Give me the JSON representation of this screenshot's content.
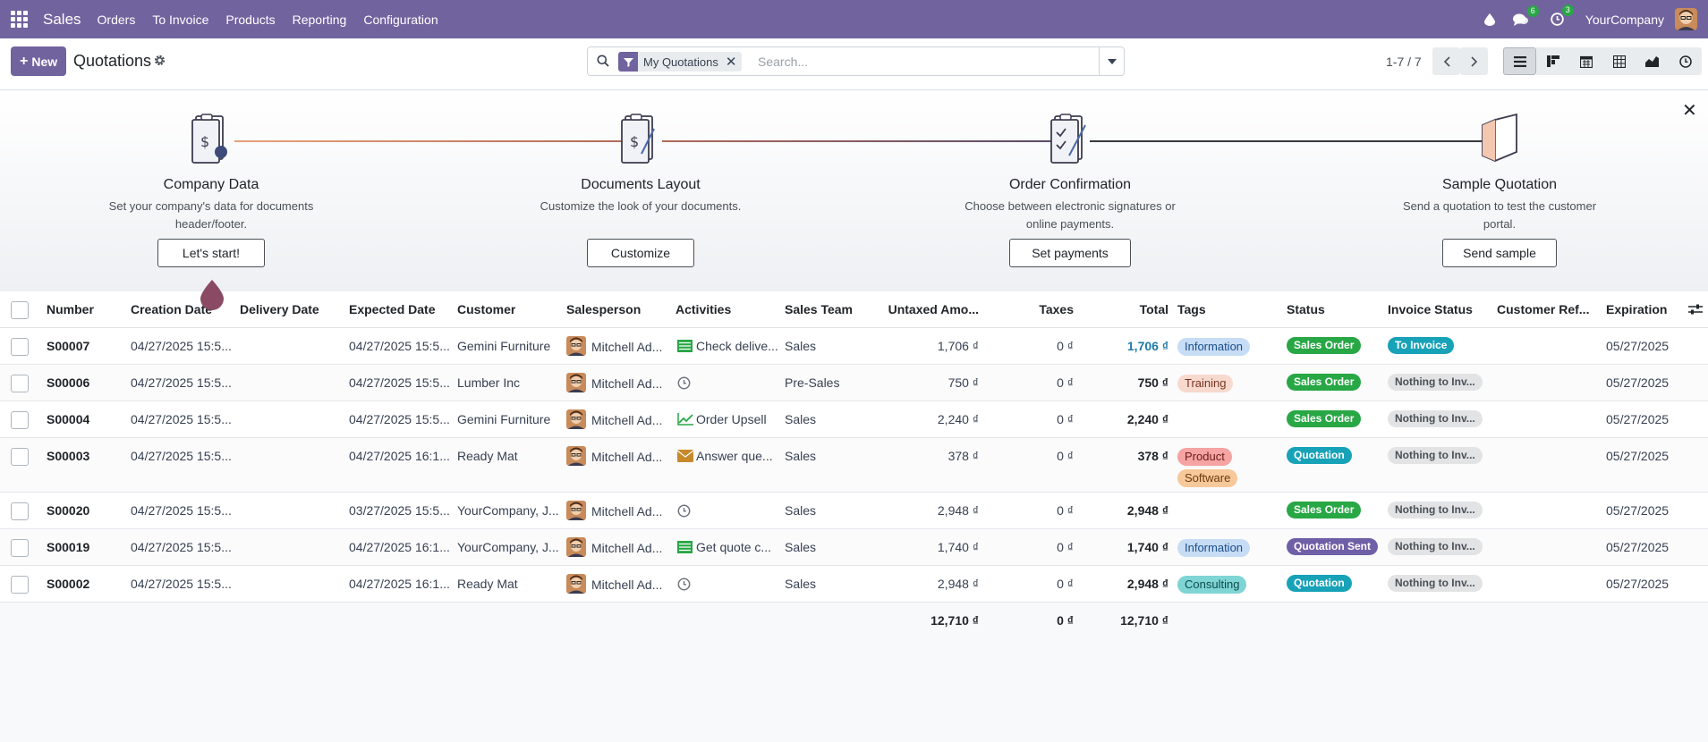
{
  "navbar": {
    "brand": "Sales",
    "menu": [
      "Orders",
      "To Invoice",
      "Products",
      "Reporting",
      "Configuration"
    ],
    "messages_count": "6",
    "activities_count": "3",
    "company": "YourCompany"
  },
  "control": {
    "new_label": "New",
    "title": "Quotations",
    "facet": "My Quotations",
    "search_placeholder": "Search...",
    "pager": "1-7 / 7"
  },
  "onboarding": {
    "steps": [
      {
        "title": "Company Data",
        "desc": "Set your company's data for documents header/footer.",
        "button": "Let's start!"
      },
      {
        "title": "Documents Layout",
        "desc": "Customize the look of your documents.",
        "button": "Customize"
      },
      {
        "title": "Order Confirmation",
        "desc": "Choose between electronic signatures or online payments.",
        "button": "Set payments"
      },
      {
        "title": "Sample Quotation",
        "desc": "Send a quotation to test the customer portal.",
        "button": "Send sample"
      }
    ]
  },
  "table": {
    "headers": [
      "Number",
      "Creation Date",
      "Delivery Date",
      "Expected Date",
      "Customer",
      "Salesperson",
      "Activities",
      "Sales Team",
      "Untaxed Amo...",
      "Taxes",
      "Total",
      "Tags",
      "Status",
      "Invoice Status",
      "Customer Ref...",
      "Expiration"
    ],
    "rows": [
      {
        "number": "S00007",
        "created": "04/27/2025 15:5...",
        "expected": "04/27/2025 15:5...",
        "customer": "Gemini Furniture",
        "salesperson": "Mitchell Ad...",
        "activity_icon": "list-icon",
        "activity": "Check delive...",
        "team": "Sales",
        "untaxed": "1,706 ₫",
        "taxes": "0 ₫",
        "total": "1,706 ₫",
        "tags": [
          {
            "label": "Information",
            "bg": "#c7dcf5",
            "fg": "#1a4f8b"
          }
        ],
        "status": {
          "label": "Sales Order",
          "bg": "#28a745"
        },
        "invoice": {
          "label": "To Invoice",
          "bg": "#17a2b8",
          "fg": "#ffffff"
        },
        "expiration": "05/27/2025"
      },
      {
        "number": "S00006",
        "created": "04/27/2025 15:5...",
        "expected": "04/27/2025 15:5...",
        "customer": "Lumber Inc",
        "salesperson": "Mitchell Ad...",
        "activity_icon": "clock-icon",
        "activity": "",
        "team": "Pre-Sales",
        "untaxed": "750 ₫",
        "taxes": "0 ₫",
        "total": "750 ₫",
        "tags": [
          {
            "label": "Training",
            "bg": "#f7d9ce",
            "fg": "#7a3420"
          }
        ],
        "status": {
          "label": "Sales Order",
          "bg": "#28a745"
        },
        "invoice": {
          "label": "Nothing to Inv...",
          "bg": "#e2e3e5",
          "fg": "#495057"
        },
        "expiration": "05/27/2025"
      },
      {
        "number": "S00004",
        "created": "04/27/2025 15:5...",
        "expected": "04/27/2025 15:5...",
        "customer": "Gemini Furniture",
        "salesperson": "Mitchell Ad...",
        "activity_icon": "chart-icon",
        "activity": "Order Upsell",
        "team": "Sales",
        "untaxed": "2,240 ₫",
        "taxes": "0 ₫",
        "total": "2,240 ₫",
        "tags": [],
        "status": {
          "label": "Sales Order",
          "bg": "#28a745"
        },
        "invoice": {
          "label": "Nothing to Inv...",
          "bg": "#e2e3e5",
          "fg": "#495057"
        },
        "expiration": "05/27/2025"
      },
      {
        "number": "S00003",
        "created": "04/27/2025 15:5...",
        "expected": "04/27/2025 16:1...",
        "customer": "Ready Mat",
        "salesperson": "Mitchell Ad...",
        "activity_icon": "envelope-icon",
        "activity": "Answer que...",
        "team": "Sales",
        "untaxed": "378 ₫",
        "taxes": "0 ₫",
        "total": "378 ₫",
        "tags": [
          {
            "label": "Product",
            "bg": "#f5a3a3",
            "fg": "#6b1a1a"
          },
          {
            "label": "Software",
            "bg": "#f7c89a",
            "fg": "#6b3a10"
          }
        ],
        "status": {
          "label": "Quotation",
          "bg": "#17a2b8"
        },
        "invoice": {
          "label": "Nothing to Inv...",
          "bg": "#e2e3e5",
          "fg": "#495057"
        },
        "expiration": "05/27/2025"
      },
      {
        "number": "S00020",
        "created": "04/27/2025 15:5...",
        "expected": "03/27/2025 15:5...",
        "customer": "YourCompany, J...",
        "salesperson": "Mitchell Ad...",
        "activity_icon": "clock-icon",
        "activity": "",
        "team": "Sales",
        "untaxed": "2,948 ₫",
        "taxes": "0 ₫",
        "total": "2,948 ₫",
        "tags": [],
        "status": {
          "label": "Sales Order",
          "bg": "#28a745"
        },
        "invoice": {
          "label": "Nothing to Inv...",
          "bg": "#e2e3e5",
          "fg": "#495057"
        },
        "expiration": "05/27/2025"
      },
      {
        "number": "S00019",
        "created": "04/27/2025 15:5...",
        "expected": "04/27/2025 16:1...",
        "customer": "YourCompany, J...",
        "salesperson": "Mitchell Ad...",
        "activity_icon": "list-icon",
        "activity": "Get quote c...",
        "team": "Sales",
        "untaxed": "1,740 ₫",
        "taxes": "0 ₫",
        "total": "1,740 ₫",
        "tags": [
          {
            "label": "Information",
            "bg": "#c7dcf5",
            "fg": "#1a4f8b"
          }
        ],
        "status": {
          "label": "Quotation Sent",
          "bg": "#6f5fa7"
        },
        "invoice": {
          "label": "Nothing to Inv...",
          "bg": "#e2e3e5",
          "fg": "#495057"
        },
        "expiration": "05/27/2025"
      },
      {
        "number": "S00002",
        "created": "04/27/2025 15:5...",
        "expected": "04/27/2025 16:1...",
        "customer": "Ready Mat",
        "salesperson": "Mitchell Ad...",
        "activity_icon": "clock-icon",
        "activity": "",
        "team": "Sales",
        "untaxed": "2,948 ₫",
        "taxes": "0 ₫",
        "total": "2,948 ₫",
        "tags": [
          {
            "label": "Consulting",
            "bg": "#7fd4d4",
            "fg": "#0e4d4d"
          }
        ],
        "status": {
          "label": "Quotation",
          "bg": "#17a2b8"
        },
        "invoice": {
          "label": "Nothing to Inv...",
          "bg": "#e2e3e5",
          "fg": "#495057"
        },
        "expiration": "05/27/2025"
      }
    ],
    "totals": {
      "untaxed": "12,710 ₫",
      "taxes": "0 ₫",
      "total": "12,710 ₫"
    }
  },
  "colors": {
    "brand": "#71639e",
    "link": "#1f7aa8"
  }
}
